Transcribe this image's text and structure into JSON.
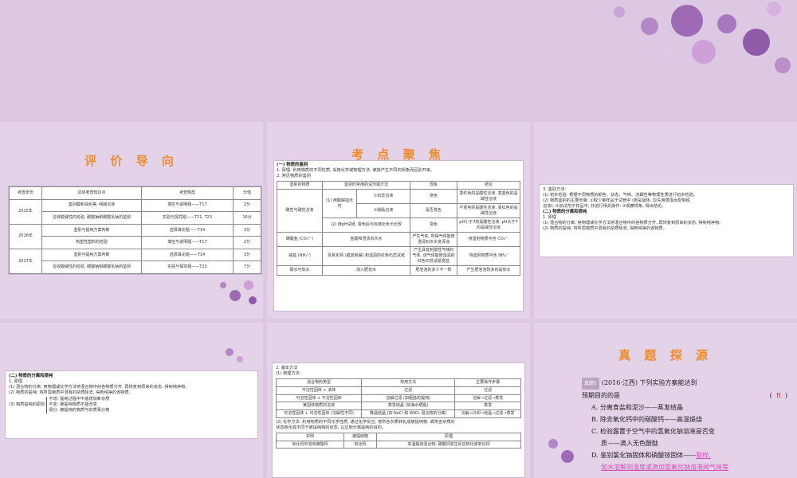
{
  "colors": {
    "title": "#ee8c2c",
    "panel": "#e4d2e8",
    "bg": "#dcc8e2",
    "bubble1": "#9b67b3",
    "bubble2": "#c89ad0",
    "answer": "#e0402e",
    "fill_answer": "#d44cb8"
  },
  "s2": {
    "title": "评 价 导 向",
    "headers": [
      "考查年份",
      "具体考查知识点",
      "考查题型",
      "分值"
    ],
    "rows": [
      {
        "year": "2015年",
        "point": "鉴别酸和油化等, 纯碱溶液",
        "type": "填空与说明题——T17",
        "score": "2分"
      },
      {
        "year": "",
        "point": "溶液酸碱性的检验, 碳酸钠和碳酸氢钠的鉴别",
        "type": "实验与探究题——T21, T23",
        "score": "16分"
      },
      {
        "year": "2016年",
        "point": "鉴别与提纯方案判断",
        "type": "选择填充题——T14",
        "score": "3分"
      },
      {
        "year": "",
        "point": "热塑性塑料的检验",
        "type": "填空与说明题——T17",
        "score": "2分"
      },
      {
        "year": "2017年",
        "point": "鉴别与提纯方案判断",
        "type": "选择填充题——T14",
        "score": "3分"
      },
      {
        "year": "",
        "point": "溶液酸碱性的检验, 碳酸钠和碳酸氢钠的鉴别",
        "type": "实验与探究题——T23",
        "score": "7分"
      }
    ]
  },
  "s3": {
    "title": "考 点 聚 焦",
    "h1": "(一) 物质的鉴别",
    "l1": "1. 原理: 利用物质的不同性质, 采用化学或物理方法, 使其产生不同的现象而区别开来。",
    "l2": "2. 常见物质的鉴别",
    "headers": [
      "鉴别的物质",
      "鉴别时常用的试剂或方法",
      "",
      "现象",
      "结论"
    ],
    "rows": [
      {
        "a": "",
        "b": "(1) 用酸碱指示剂",
        "c": "①石蕊溶液",
        "d": "变色",
        "e": "变红色的是酸性溶液, 变蓝色的是碱性溶液"
      },
      {
        "a": "酸性与碱性溶液",
        "b": "",
        "c": "②酚酞溶液",
        "d": "是否变色",
        "e": "不变色的是酸性溶液, 变红色的是碱性溶液"
      },
      {
        "a": "",
        "b": "(2) 用pH试纸, 变色后与标准比色卡比较",
        "c": "",
        "d": "变色",
        "e": "pH小于7的是酸性溶液, pH大于7的是碱性溶液"
      },
      {
        "a": "碳酸盐 (CO₃²⁻)",
        "b": "盐酸和澄清石灰水",
        "c": "",
        "d": "产生气体, 所得气体能使澄清石灰水变浑浊",
        "e": "待鉴别物质中含 CO₃²⁻"
      },
      {
        "a": "铵盐 (NH₄⁺)",
        "b": "氢氧化钙 (或其他碱) 和湿润的红色石蕊试纸",
        "c": "",
        "d": "产生具有刺激性气味的气体, 该气体能使湿润的红色石蕊试纸变蓝",
        "e": "待鉴别物质中含 NH₄⁺"
      },
      {
        "a": "硬水与软水",
        "b": "加入肥皂水",
        "c": "",
        "d": "肥皂泡的多少不一样",
        "e": "产生肥皂泡较多的是软水"
      }
    ]
  },
  "s4": {
    "lines": [
      "3. 鉴别方法:",
      "(1) 初步检验: 根据不同物质的颜色、状态、气味、溶解性等物理性质进行初步检验。",
      "(2) 物质鉴别的主要步骤: ①取少量样品于试管中 (若是固体, 应先用蒸馏水配制成",
      "溶液); ②加试剂于样品中, 并进行相关操作; ③观察现象, 得出结论。"
    ],
    "h2": "(二) 物质的分离和提纯",
    "sub": "1. 原理",
    "l1": "(1) 混合物的分离: 用物理或化学方法将混合物中的各物质分开, 再恢复到原来的状态, 得到纯净物。",
    "l2": "(2) 物质的提纯: 将所需物质中混有的杂质除去, 得到纯净的该物质。"
  },
  "s5": {
    "h": "(二) 物质的分离和提纯",
    "sub": "1. 原理",
    "l1": "(1) 混合物的分离: 用物理或化学方法将混合物中的各物质分开, 再恢复到原来的状态, 得到纯净物。",
    "l2": "(2) 物质的提纯: 将所需物质中混有的杂质除去, 得到纯净的该物质。",
    "l3": "(3) 物质提纯的原则",
    "r1": "不增: 提纯过程中不能增加新杂质",
    "r2": "不变: 被提纯物质不能改变",
    "r3": "易分: 被提纯的物质与杂质易分离"
  },
  "s6": {
    "l0": "2. 基本方法",
    "l1": "(1) 物理方法:",
    "headers": [
      "混合物的类型",
      "常用方法",
      "主要操作步骤"
    ],
    "rows": [
      {
        "a": "不溶性固体 + 液体",
        "b": "过滤",
        "c": "过滤"
      },
      {
        "a": "可溶性固体 + 不溶性固体",
        "b": "溶解过滤 (如粗盐的提纯)",
        "c": "溶解→过滤→蒸发"
      },
      {
        "a": "某固体物质的溶液",
        "b": "蒸发结晶 (如海水晒盐)",
        "c": "蒸发"
      },
      {
        "a": "可溶性固体 + 可溶性固体 (溶解性不同)",
        "b": "降温结晶 (如 NaCl 和 KNO₃ 混合物的分离)",
        "c": "溶解→冷却→结晶→过滤→蒸发"
      }
    ],
    "l2": "(2) 化学方法: 利用物质的不同化学性质, 通过化学反应, 将所含杂质转化成被提纯物, 或将含杂质的",
    "l3": "状态转化成不同于被提纯物的状态, 以达到分离提纯的目的。",
    "h2": [
      "实例",
      "被提纯物",
      "原理"
    ],
    "r1": {
      "a": "氧化钙中混有碳酸钙",
      "b": "氧化钙",
      "c": "高温煅烧混合物, 碳酸钙发生反应转化成氧化钙"
    }
  },
  "s7": {
    "title": "真 题 探 源",
    "tag": "真题1",
    "q1": "(2016·江西) 下列实验方案能达到",
    "q2": "预期目的的是",
    "paren_open": "(",
    "answer": "B",
    "paren_close": ")",
    "A": "A. 分离食盐和泥沙——蒸发结晶",
    "Bopt": "B. 除去氧化钙中的碳酸钙——高温煅烧",
    "C1": "C. 检验露置于空气中的氢氧化钠溶液是否变",
    "C2": "质——滴入无色酚酞",
    "D1": "D. 鉴别氯化钠固体和硝酸铵固体——",
    "D1ans": "取样,",
    "D2ans": "加水溶解测温度或滴加氢氧化钠溶液闻气味等"
  }
}
